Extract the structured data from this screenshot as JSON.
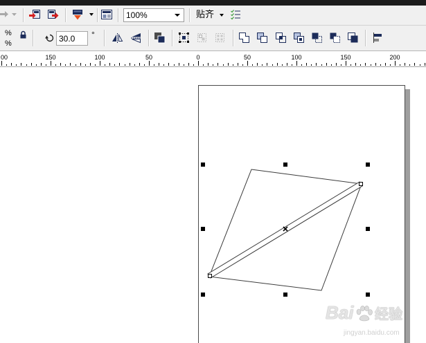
{
  "colors": {
    "title_bar": "#1c1c1c",
    "toolbar_bg": "#f0f0f0",
    "icon_navy": "#1c2c5a",
    "icon_red": "#d42020",
    "disabled_icon": "#b4b4b4",
    "canvas_bg": "#ffffff",
    "page_outline": "#4a4a4a",
    "page_shadow": "#9e9e9e",
    "selection_handle": "#000000"
  },
  "standard_toolbar": {
    "redo": {
      "icon": "redo-icon",
      "enabled": false
    },
    "redo_menu": {
      "icon": "chevron-down-icon",
      "enabled": false
    },
    "import": {
      "icon": "import-icon"
    },
    "export": {
      "icon": "export-icon"
    },
    "application_launcher": {
      "icon": "application-launcher-icon"
    },
    "welcome_screen": {
      "icon": "welcome-screen-icon"
    },
    "zoom": {
      "value": "100%"
    },
    "snap_to": {
      "label": "贴齐"
    },
    "options": {
      "icon": "snap-options-icon"
    }
  },
  "property_bar": {
    "scale": {
      "x_unit": "%",
      "y_unit": "%",
      "lock_icon": "lock-icon"
    },
    "rotation": {
      "icon": "rotation-icon",
      "value": "30.0",
      "unit": "°"
    },
    "mirror": [
      "mirror-horizontal-icon",
      "mirror-vertical-icon"
    ],
    "arrange": [
      {
        "icon": "combine-icon",
        "enabled": true
      },
      {
        "icon": "group-icon",
        "enabled": true
      },
      {
        "icon": "ungroup-icon",
        "enabled": false
      },
      {
        "icon": "ungroup-all-icon",
        "enabled": false
      }
    ],
    "shaping": [
      "weld-icon",
      "trim-icon",
      "intersect-icon",
      "simplify-icon",
      "front-minus-back-icon",
      "back-minus-front-icon",
      "create-boundary-icon"
    ],
    "align": "align-distribute-icon"
  },
  "ruler": {
    "labels": [
      "00",
      "150",
      "100",
      "50",
      "0",
      "50",
      "100",
      "150",
      "200"
    ]
  },
  "watermark": {
    "brand": "Bai",
    "product": "经验",
    "url": "jingyan.baidu.com"
  }
}
